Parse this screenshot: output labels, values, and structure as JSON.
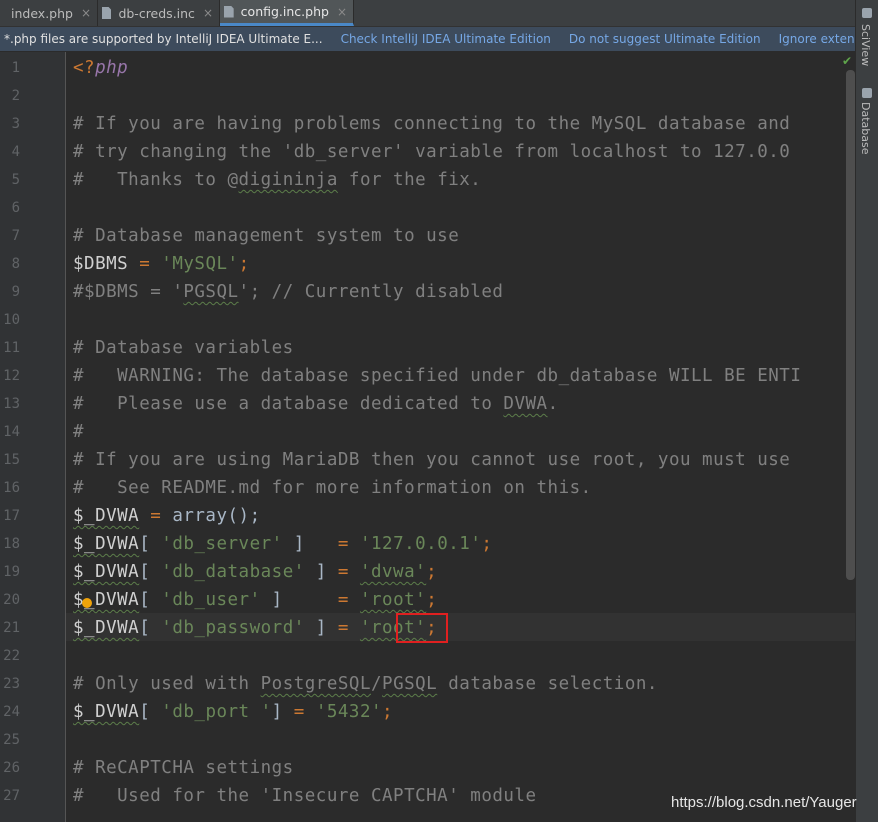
{
  "tabs": [
    {
      "name": "index.php",
      "close": "×"
    },
    {
      "name": "db-creds.inc",
      "close": "×"
    },
    {
      "name": "config.inc.php",
      "close": "×"
    }
  ],
  "banner": {
    "message": "*.php files are supported by IntelliJ IDEA Ultimate E...",
    "links": [
      "Check IntelliJ IDEA Ultimate Edition",
      "Do not suggest Ultimate Edition",
      "Ignore extension"
    ]
  },
  "side_panel": {
    "tabs": [
      "SciView",
      "Database"
    ]
  },
  "line_numbers": [
    "1",
    "2",
    "3",
    "4",
    "5",
    "6",
    "7",
    "8",
    "9",
    "10",
    "11",
    "12",
    "13",
    "14",
    "15",
    "16",
    "17",
    "18",
    "19",
    "20",
    "21",
    "22",
    "23",
    "24",
    "25",
    "26",
    "27"
  ],
  "code": {
    "l1": {
      "open": "<?",
      "kw": "php"
    },
    "l3": "# If you are having problems connecting to the MySQL database and",
    "l4": "# try changing the 'db_server' variable from localhost to 127.0.0",
    "l5a": "#   Thanks to @",
    "l5b": "digininja",
    "l5c": " for the fix.",
    "l7": "# Database management system to use",
    "l8": {
      "var": "$DBMS",
      "op": " = ",
      "str": "'MySQL'",
      "end": ";"
    },
    "l9a": "#$DBMS = '",
    "l9b": "PGSQL",
    "l9c": "'; // Currently disabled",
    "l11": "# Database variables",
    "l12": "#   WARNING: The database specified under db_database WILL BE ENTI",
    "l13a": "#   Please use a database dedicated to ",
    "l13b": "DVWA",
    "l13c": ".",
    "l14": "#",
    "l15": "# If you are using MariaDB then you cannot use root, you must use",
    "l16": "#   See README.md for more information on this.",
    "l17": {
      "var": "$_DVWA",
      "op": " = ",
      "fn": "array();"
    },
    "l18": {
      "var": "$_DVWA",
      "br": "[ ",
      "key": "'db_server'",
      "br2": " ]   ",
      "op": "= ",
      "str": "'127.0.0.1'",
      "end": ";"
    },
    "l19": {
      "var": "$_DVWA",
      "br": "[ ",
      "key": "'db_database'",
      "br2": " ] ",
      "op": "= ",
      "str": "'dvwa'",
      "end": ";"
    },
    "l20": {
      "var": "$_DVWA",
      "br": "[ ",
      "key": "'db_user'",
      "br2": " ]     ",
      "op": "= ",
      "str": "'root'",
      "end": ";"
    },
    "l21": {
      "var": "$_DVWA",
      "br": "[ ",
      "key": "'db_password'",
      "br2": " ] ",
      "op": "= ",
      "str": "'root'",
      "end": ";"
    },
    "l23a": "# Only used with ",
    "l23b": "PostgreSQL",
    "l23c": "/",
    "l23d": "PGSQL",
    "l23e": " database selection.",
    "l24": {
      "var": "$_DVWA",
      "br": "[ ",
      "key": "'db_port '",
      "br2": "] ",
      "op": "= ",
      "str": "'5432'",
      "end": ";"
    },
    "l26": "# ReCAPTCHA settings",
    "l27": "#   Used for the 'Insecure CAPTCHA' module"
  },
  "watermark": "https://blog.csdn.net/Yauger"
}
